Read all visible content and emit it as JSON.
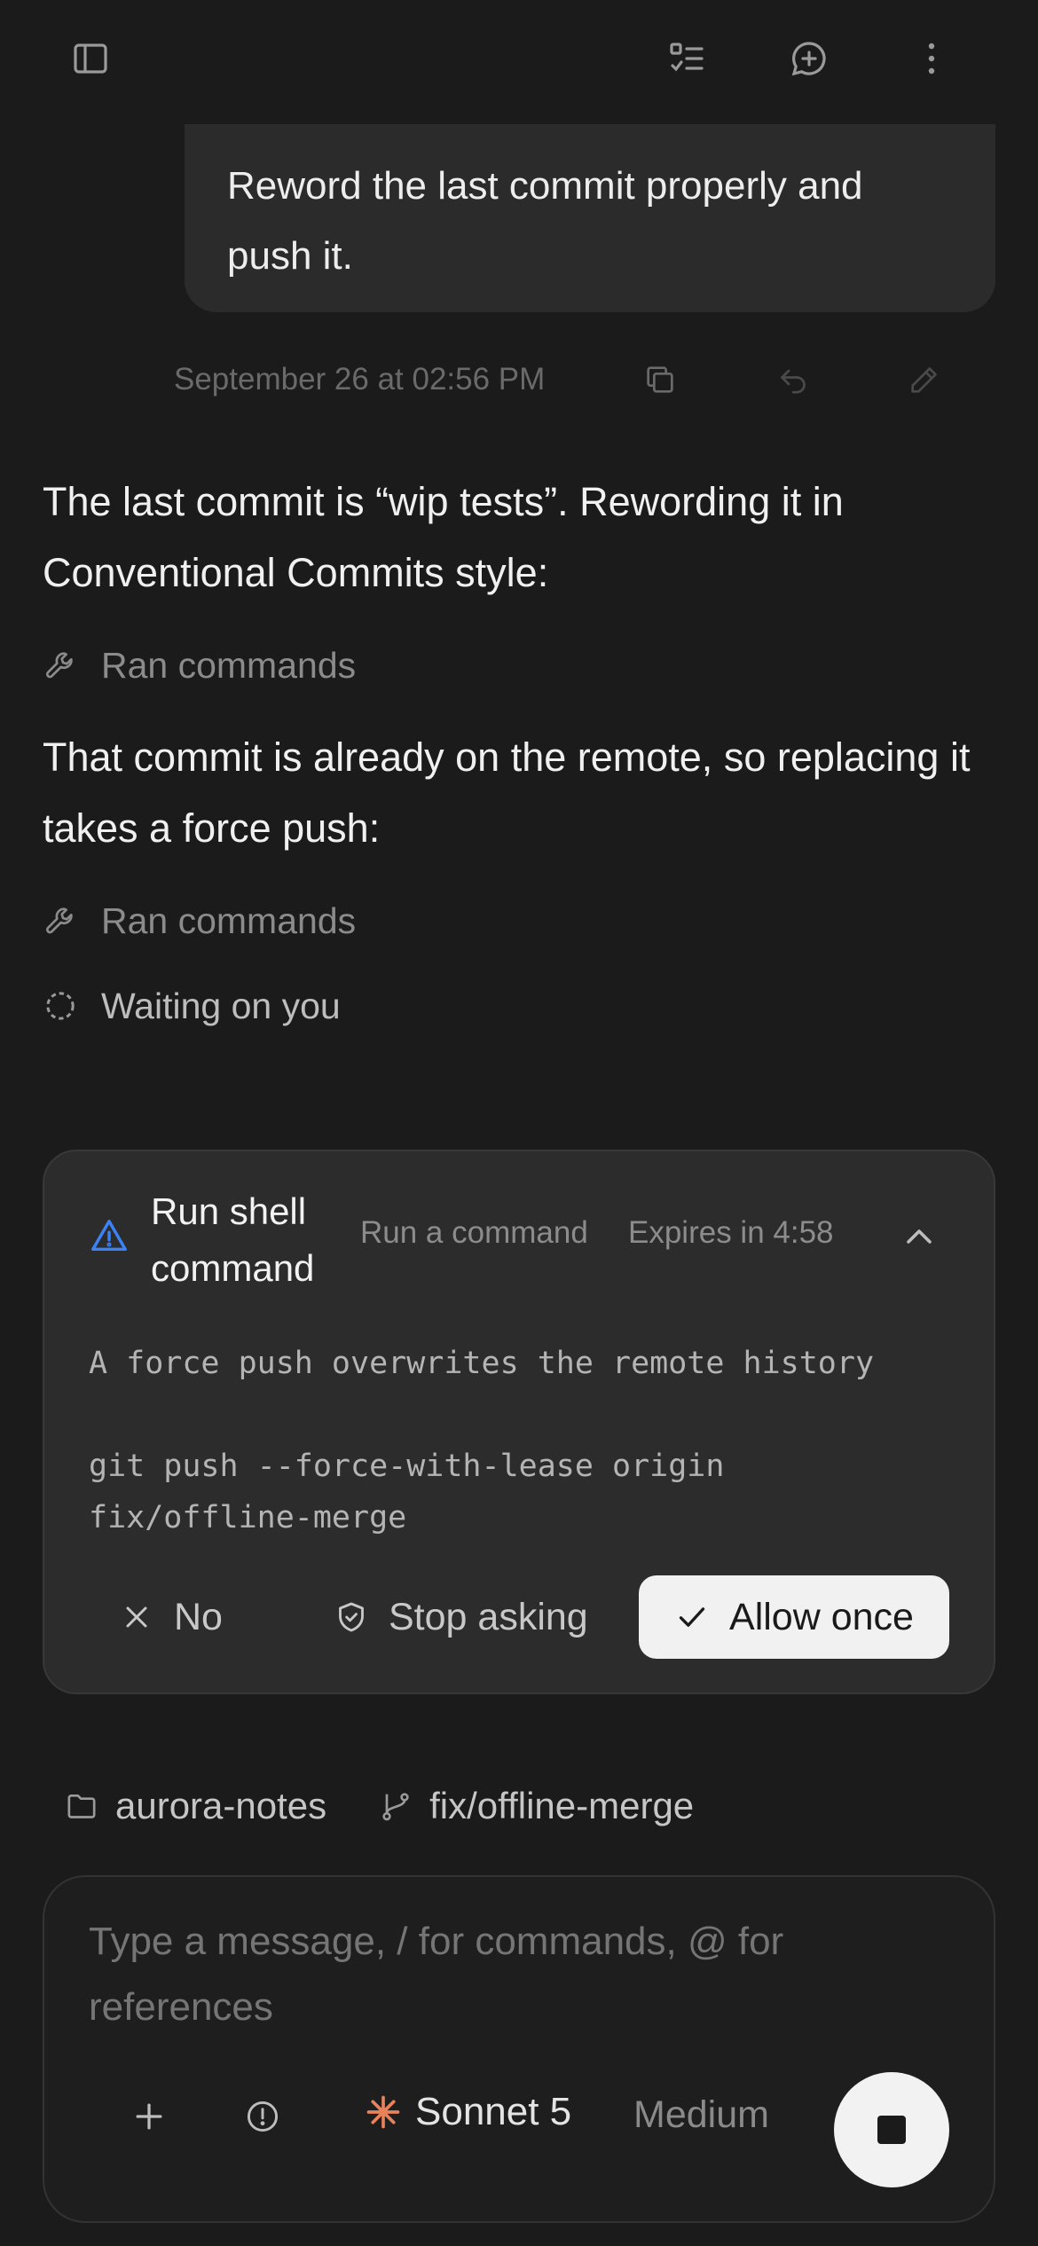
{
  "header": {
    "sidebar_icon": "sidebar-toggle-icon",
    "tasks_icon": "checklist-icon",
    "new_chat_icon": "new-chat-icon",
    "menu_icon": "more-vertical-icon"
  },
  "conversation": {
    "user_message": "Reword the last commit properly and push it.",
    "timestamp": "September 26 at 02:56 PM",
    "assistant_1": "The last commit is “wip tests”. Rewording it in Conventional Commits style:",
    "tool_1": "Ran commands",
    "assistant_2": "That commit is already on the remote, so replacing it takes a force push:",
    "tool_2": "Ran commands",
    "status": "Waiting on you"
  },
  "permission": {
    "title": "Run shell command",
    "subtitle": "Run a command",
    "expires": "Expires in 4:58",
    "description": "A force push overwrites the remote history",
    "command": "git push --force-with-lease origin fix/offline-merge",
    "no_label": "No",
    "stop_asking_label": "Stop asking",
    "allow_label": "Allow once",
    "warning_color": "#3b82f6"
  },
  "context": {
    "folder": "aurora-notes",
    "branch": "fix/offline-merge"
  },
  "composer": {
    "placeholder": "Type a message, / for commands, @ for references",
    "model": "Sonnet 5",
    "effort": "Medium",
    "model_icon_color": "#e8825a"
  }
}
